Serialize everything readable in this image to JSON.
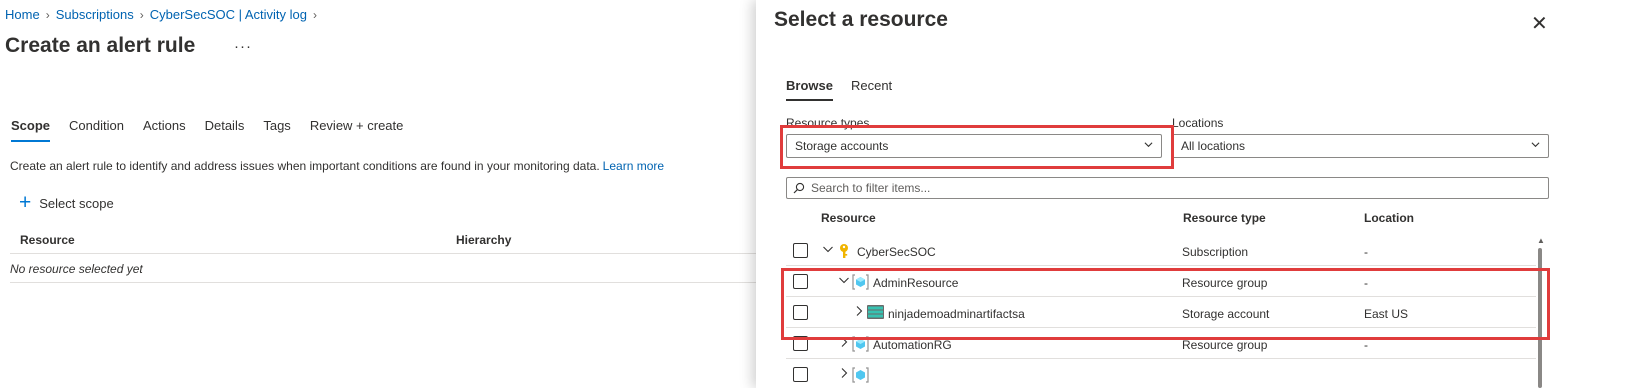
{
  "breadcrumb": {
    "items": [
      "Home",
      "Subscriptions",
      "CyberSecSOC | Activity log"
    ]
  },
  "page": {
    "title": "Create an alert rule",
    "more": "···"
  },
  "tabs": [
    "Scope",
    "Condition",
    "Actions",
    "Details",
    "Tags",
    "Review + create"
  ],
  "description": {
    "text": "Create an alert rule to identify and address issues when important conditions are found in your monitoring data.",
    "link": "Learn more"
  },
  "select_scope": {
    "label": "Select scope"
  },
  "scope_table": {
    "columns": [
      "Resource",
      "Hierarchy"
    ],
    "empty_text": "No resource selected yet"
  },
  "panel": {
    "title": "Select a resource",
    "close": "✕",
    "tabs": [
      "Browse",
      "Recent"
    ],
    "resource_types_label": "Resource types",
    "resource_types_value": "Storage accounts",
    "locations_label": "Locations",
    "locations_value": "All locations",
    "search_placeholder": "Search to filter items...",
    "columns": [
      "Resource",
      "Resource type",
      "Location"
    ],
    "rows": [
      {
        "name": "CyberSecSOC",
        "type": "Subscription",
        "location": "-",
        "icon": "key-icon",
        "expander": "collapse"
      },
      {
        "name": "AdminResource",
        "type": "Resource group",
        "location": "-",
        "icon": "resource-group-icon",
        "expander": "collapse"
      },
      {
        "name": "ninjademoadminartifactsa",
        "type": "Storage account",
        "location": "East US",
        "icon": "storage-account-icon",
        "expander": "expand"
      },
      {
        "name": "AutomationRG",
        "type": "Resource group",
        "location": "-",
        "icon": "resource-group-icon",
        "expander": "expand"
      },
      {
        "name": "",
        "type": "",
        "location": "",
        "icon": "resource-group-icon",
        "expander": "expand"
      }
    ]
  },
  "colors": {
    "accent": "#0078d4",
    "link": "#0063b1",
    "highlight": "#e03c3c"
  }
}
